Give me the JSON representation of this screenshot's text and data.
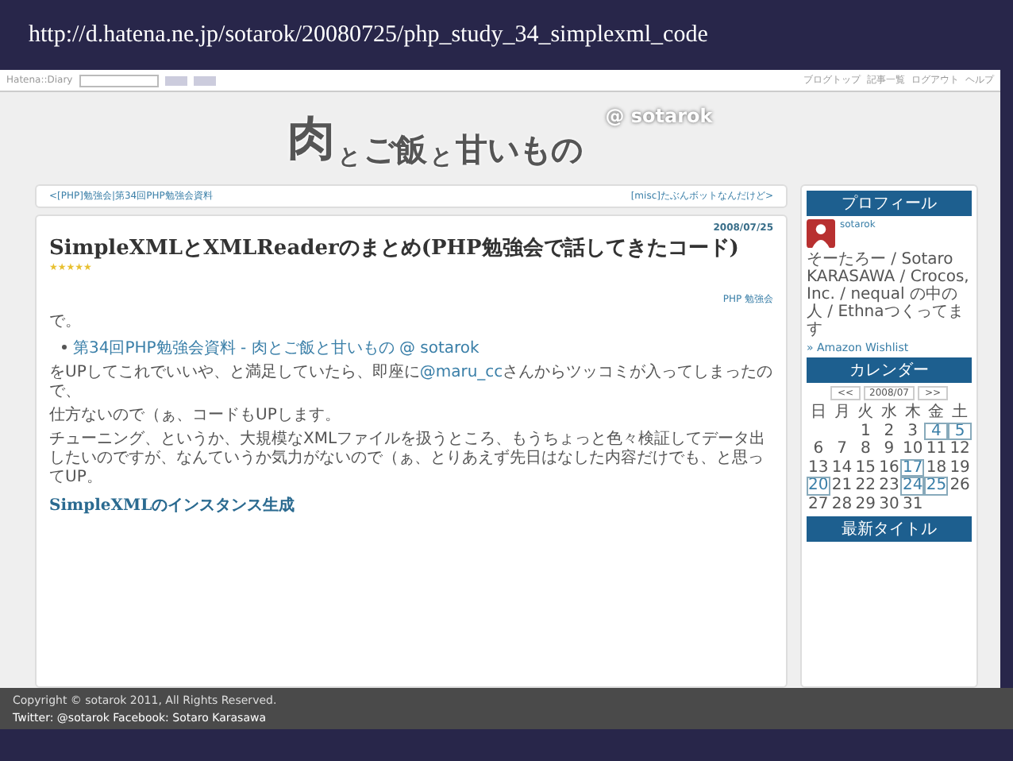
{
  "slide_title": "http://d.hatena.ne.jp/sotarok/20080725/php_study_34_simplexml_code",
  "blog_header": {
    "site_label": "Hatena::Diary",
    "links": [
      "ブログトップ",
      "記事一覧",
      "ログアウト",
      "ヘルプ"
    ]
  },
  "logo": {
    "parts": [
      "肉",
      "と",
      "ご飯",
      "と",
      "甘いもの"
    ],
    "handle": "@ sotarok"
  },
  "nav": {
    "previous": "<[PHP]勉強会|第34回PHP勉強会資料",
    "next": "[misc]たぶんボットなんだけど>"
  },
  "article": {
    "date": "2008/07/25",
    "title": "SimpleXMLとXMLReaderのまとめ(PHP勉強会で話してきたコード)",
    "rating": "★★★★★",
    "tag": "PHP 勉強会",
    "paragraphs": [
      {
        "kind": "text",
        "text": "で。"
      },
      {
        "kind": "bullet",
        "link": "第34回PHP勉強会資料 - 肉とご飯と甘いもの @ sotarok"
      },
      {
        "kind": "text",
        "before": "をUPしてこれでいいや、と満足していたら、即座に",
        "link": "@maru_cc",
        "text": "さんからツッコミが入ってしまったので、"
      },
      {
        "kind": "text",
        "text": "仕方ないので（ぁ、コードもUPします。"
      },
      {
        "kind": "text",
        "text": "チューニング、というか、大規模なXMLファイルを扱うところ、もうちょっと色々検証してデータ出したいのですが、なんていうか気力がないので（ぁ、とりあえず先日はなした内容だけでも、と思ってUP。"
      },
      {
        "kind": "heading",
        "text": "SimpleXMLのインスタンス生成"
      }
    ]
  },
  "sidebar": {
    "profile": {
      "heading": "プロフィール",
      "name": "sotarok",
      "bio": "そーたろー / Sotaro KARASAWA / Crocos, Inc. / nequal の中の人 / Ethnaつくってます",
      "wishlist": "» Amazon Wishlist"
    },
    "calendar": {
      "heading": "カレンダー",
      "prev": "<<",
      "month": "2008/07",
      "next": ">>",
      "weekdays": [
        "日",
        "月",
        "火",
        "水",
        "木",
        "金",
        "土"
      ],
      "weeks": [
        [
          {
            "day": "1",
            "linked": false
          },
          {
            "day": "2",
            "linked": false
          },
          {
            "day": "3",
            "linked": false
          },
          {
            "day": "4",
            "linked": true
          },
          {
            "day": "5",
            "linked": true
          }
        ],
        [
          {
            "day": "6",
            "linked": false
          },
          {
            "day": "7",
            "linked": false
          },
          {
            "day": "8",
            "linked": false
          },
          {
            "day": "9",
            "linked": false
          },
          {
            "day": "10",
            "linked": false
          },
          {
            "day": "11",
            "linked": false
          },
          {
            "day": "12",
            "linked": false
          }
        ],
        [
          {
            "day": "13",
            "linked": false
          },
          {
            "day": "14",
            "linked": false
          },
          {
            "day": "15",
            "linked": false
          },
          {
            "day": "16",
            "linked": false
          },
          {
            "day": "17",
            "linked": true
          },
          {
            "day": "18",
            "linked": false
          },
          {
            "day": "19",
            "linked": false
          }
        ],
        [
          {
            "day": "20",
            "linked": true
          },
          {
            "day": "21",
            "linked": false
          },
          {
            "day": "22",
            "linked": false
          },
          {
            "day": "23",
            "linked": false
          },
          {
            "day": "24",
            "linked": true
          },
          {
            "day": "25",
            "linked": true
          },
          {
            "day": "26",
            "linked": false
          }
        ],
        [
          {
            "day": "27",
            "linked": false
          },
          {
            "day": "28",
            "linked": false
          },
          {
            "day": "29",
            "linked": false
          },
          {
            "day": "30",
            "linked": false
          },
          {
            "day": "31",
            "linked": false
          }
        ]
      ]
    },
    "recent_heading": "最新タイトル"
  },
  "footer": {
    "copyright": "Copyright © sotarok 2011, All Rights Reserved.",
    "social": "Twitter: @sotarok Facebook: Sotaro Karasawa"
  }
}
